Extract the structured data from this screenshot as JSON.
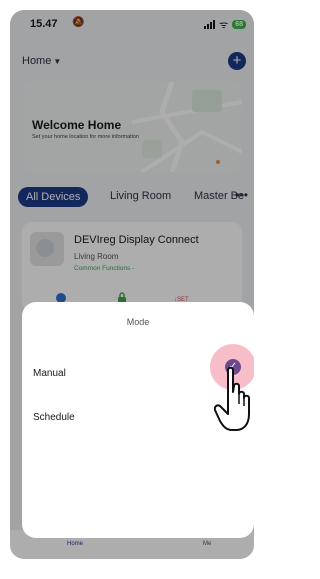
{
  "status_bar": {
    "time": "15.47",
    "battery": "68"
  },
  "header": {
    "home_label": "Home"
  },
  "welcome": {
    "title": "Welcome Home",
    "subtitle": "Set your home location for more information"
  },
  "tabs": {
    "items": [
      "All Devices",
      "Living Room",
      "Master Be"
    ],
    "active": "All Devices"
  },
  "device": {
    "name": "DEVIreg Display Connect",
    "room": "Living Room",
    "functions": "Common Functions -"
  },
  "bottom_nav": {
    "items": [
      "Home",
      "Me"
    ]
  },
  "mode_sheet": {
    "title": "Mode",
    "options": [
      {
        "label": "Manual",
        "selected": true
      },
      {
        "label": "Schedule",
        "selected": false
      }
    ]
  },
  "colors": {
    "accent": "#1d3a8a",
    "check": "#6e4a8c",
    "function_text": "#3aa84a",
    "battery": "#3ab54a"
  }
}
